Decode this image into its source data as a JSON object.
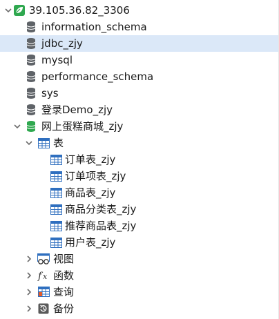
{
  "tree": {
    "connection": {
      "label": "39.105.36.82_3306",
      "icon": "connection-leaf-icon",
      "color": "#2fa84f"
    },
    "databases": [
      {
        "label": "information_schema",
        "icon": "database-icon"
      },
      {
        "label": "jdbc_zjy",
        "icon": "database-icon",
        "selected": true
      },
      {
        "label": "mysql",
        "icon": "database-icon"
      },
      {
        "label": "performance_schema",
        "icon": "database-icon"
      },
      {
        "label": "sys",
        "icon": "database-icon"
      },
      {
        "label": "登录Demo_zjy",
        "icon": "database-icon"
      }
    ],
    "open_database": {
      "label": "网上蛋糕商城_zjy",
      "icon": "database-open-icon",
      "color": "#2fa84f",
      "tables_group": {
        "label": "表",
        "icon": "table-group-icon",
        "tables": [
          {
            "label": "订单表_zjy",
            "icon": "table-icon"
          },
          {
            "label": "订单项表_zjy",
            "icon": "table-icon"
          },
          {
            "label": "商品表_zjy",
            "icon": "table-icon"
          },
          {
            "label": "商品分类表_zjy",
            "icon": "table-icon"
          },
          {
            "label": "推荐商品表_zjy",
            "icon": "table-icon"
          },
          {
            "label": "用户表_zjy",
            "icon": "table-icon"
          }
        ]
      },
      "groups": [
        {
          "label": "视图",
          "icon": "view-icon"
        },
        {
          "label": "函数",
          "icon": "function-icon"
        },
        {
          "label": "查询",
          "icon": "query-icon"
        },
        {
          "label": "备份",
          "icon": "backup-icon"
        }
      ]
    }
  },
  "colors": {
    "selection": "#dbe8f8",
    "db_gray": "#5f6368",
    "table_blue": "#2f6fbf",
    "chevron": "#6b6b6b"
  }
}
